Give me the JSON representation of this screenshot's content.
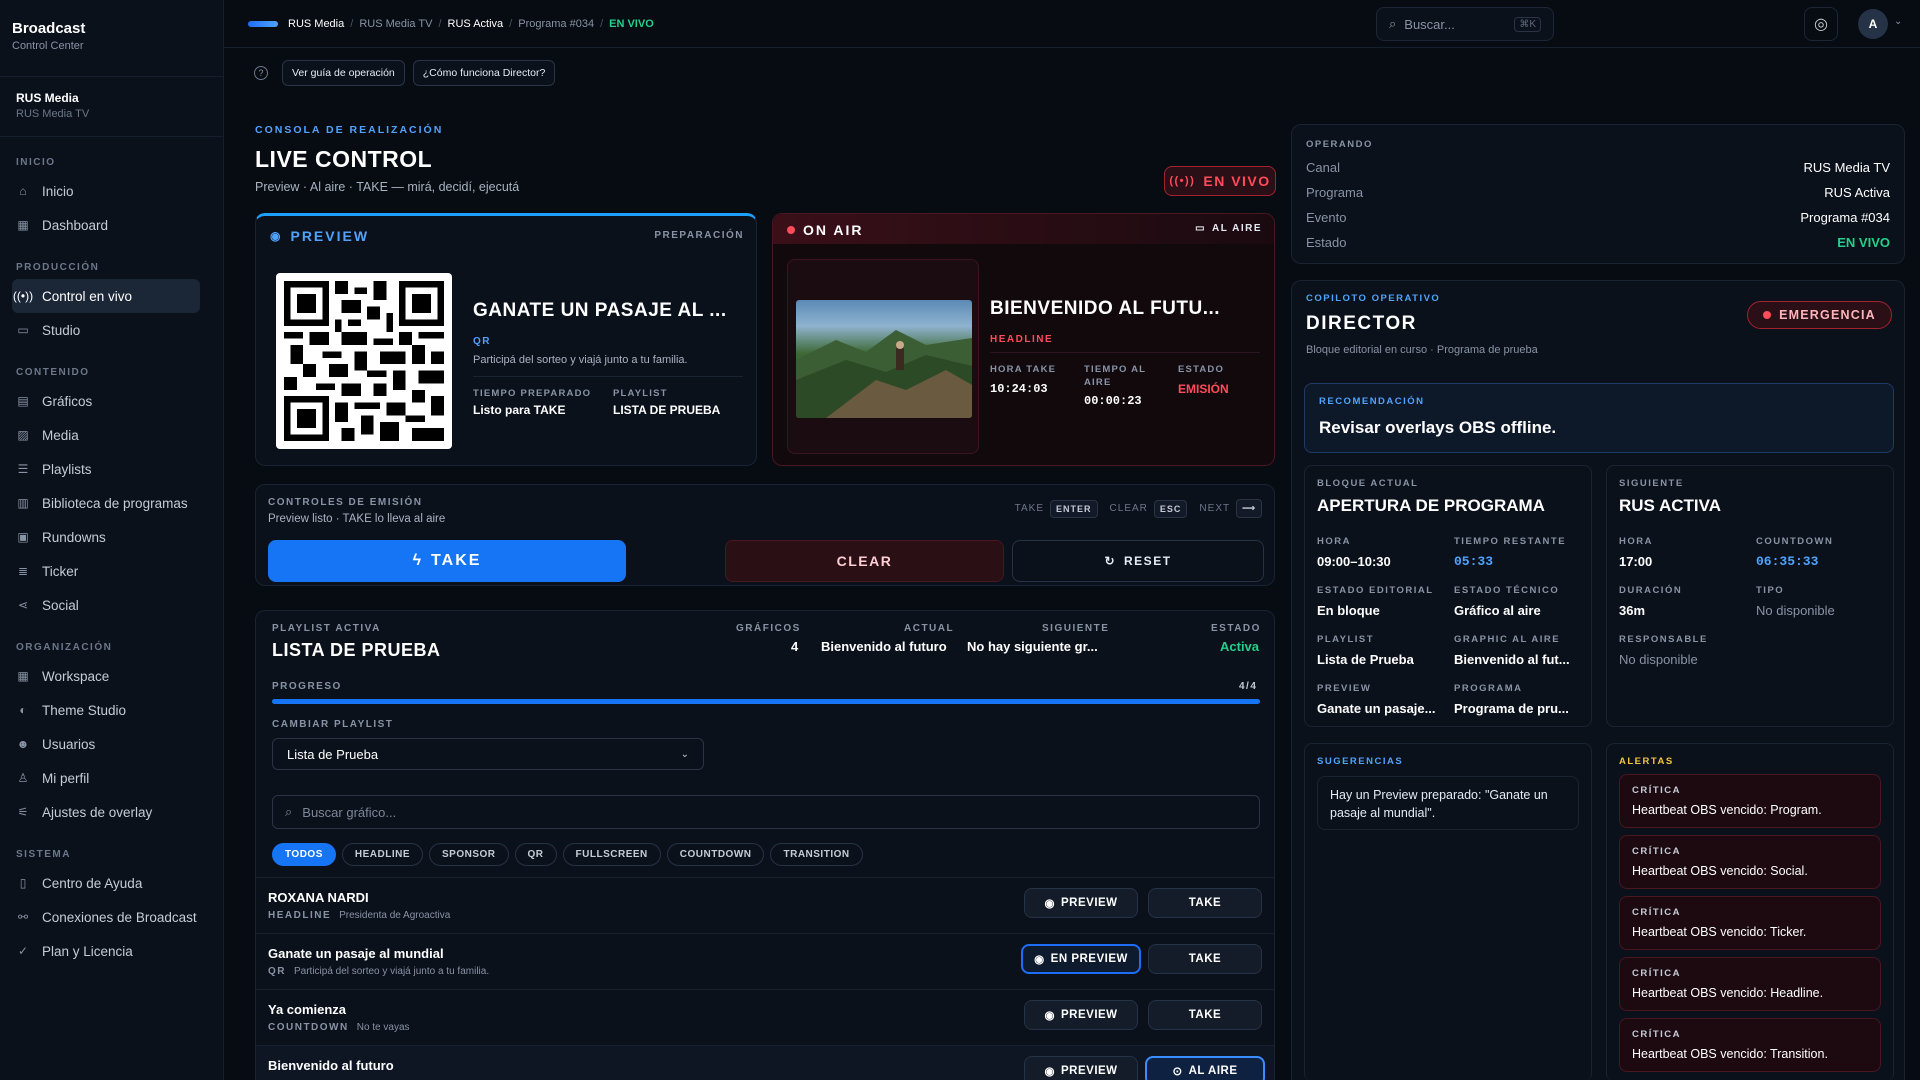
{
  "brand": {
    "title": "Broadcast",
    "subtitle": "Control Center"
  },
  "org": {
    "name": "RUS Media",
    "sub": "RUS Media TV"
  },
  "nav": {
    "inicio_label": "INICIO",
    "inicio": [
      "Inicio",
      "Dashboard"
    ],
    "produccion_label": "PRODUCCIÓN",
    "produccion": [
      "Control en vivo",
      "Studio"
    ],
    "contenido_label": "CONTENIDO",
    "contenido": [
      "Gráficos",
      "Media",
      "Playlists",
      "Biblioteca de programas",
      "Rundowns",
      "Ticker",
      "Social"
    ],
    "organizacion_label": "ORGANIZACIÓN",
    "organizacion": [
      "Workspace",
      "Theme Studio",
      "Usuarios",
      "Mi perfil",
      "Ajustes de overlay"
    ],
    "sistema_label": "SISTEMA",
    "sistema": [
      "Centro de Ayuda",
      "Conexiones de Broadcast",
      "Plan y Licencia"
    ]
  },
  "topbar": {
    "crumbs": [
      "RUS Media",
      "RUS Media TV",
      "RUS Activa",
      "Programa #034",
      "EN VIVO"
    ],
    "search_placeholder": "Buscar...",
    "search_kbd": "⌘K",
    "avatar": "A"
  },
  "help": {
    "guide": "Ver guía de operación",
    "how": "¿Cómo funciona Director?"
  },
  "header": {
    "kicker": "CONSOLA DE REALIZACIÓN",
    "title": "LIVE CONTROL",
    "subtitle": "Preview · Al aire · TAKE — mirá, decidí, ejecutá",
    "live": "EN VIVO"
  },
  "preview": {
    "label": "PREVIEW",
    "right": "PREPARACIÓN",
    "title": "GANATE UN PASAJE AL ...",
    "type": "QR",
    "desc": "Participá del sorteo y viajá junto a tu familia.",
    "k1": "TIEMPO PREPARADO",
    "v1": "Listo para TAKE",
    "k2": "PLAYLIST",
    "v2": "LISTA DE PRUEBA"
  },
  "onair": {
    "label": "ON AIR",
    "right": "AL AIRE",
    "title": "BIENVENIDO AL FUTU...",
    "type": "HEADLINE",
    "k1": "HORA TAKE",
    "v1": "10:24:03",
    "k2a": "TIEMPO AL",
    "k2b": "AIRE",
    "v2": "00:00:23",
    "k3": "ESTADO",
    "v3": "EMISIÓN"
  },
  "controls": {
    "title": "CONTROLES DE EMISIÓN",
    "sub": "Preview listo · TAKE lo lleva al aire",
    "take_key_label": "TAKE",
    "take_key": "ENTER",
    "clear_key_label": "CLEAR",
    "clear_key": "ESC",
    "next_key_label": "NEXT",
    "next_key": "⟶",
    "take": "TAKE",
    "clear": "CLEAR",
    "reset": "RESET"
  },
  "playlist": {
    "kicker": "PLAYLIST ACTIVA",
    "name": "LISTA DE PRUEBA",
    "k_graficos": "GRÁFICOS",
    "graficos": "4",
    "k_actual": "ACTUAL",
    "actual": "Bienvenido al futuro",
    "k_siguiente": "SIGUIENTE",
    "siguiente": "No hay siguiente gr...",
    "k_estado": "ESTADO",
    "estado": "Activa",
    "k_progreso": "PROGRESO",
    "progreso_text": "4/4",
    "progreso": 1.0,
    "k_cambiar": "CAMBIAR PLAYLIST",
    "select": "Lista de Prueba",
    "search_placeholder": "Buscar gráfico...",
    "chips": [
      "TODOS",
      "HEADLINE",
      "SPONSOR",
      "QR",
      "FULLSCREEN",
      "COUNTDOWN",
      "TRANSITION"
    ],
    "rows": [
      {
        "name": "ROXANA NARDI",
        "type": "HEADLINE",
        "desc": "Presidenta de Agroactiva",
        "b1": "PREVIEW",
        "b2": "TAKE"
      },
      {
        "name": "Ganate un pasaje al mundial",
        "type": "QR",
        "desc": "Participá del sorteo y viajá junto a tu familia.",
        "b1": "EN PREVIEW",
        "b2": "TAKE"
      },
      {
        "name": "Ya comienza",
        "type": "COUNTDOWN",
        "desc": "No te vayas",
        "b1": "PREVIEW",
        "b2": "TAKE"
      },
      {
        "name": "Bienvenido al futuro",
        "type": "HEADLINE",
        "desc": "",
        "b1": "PREVIEW",
        "b2": "AL AIRE"
      }
    ]
  },
  "operando": {
    "kicker": "OPERANDO",
    "rows": [
      [
        "Canal",
        "RUS Media TV"
      ],
      [
        "Programa",
        "RUS Activa"
      ],
      [
        "Evento",
        "Programa #034"
      ],
      [
        "Estado",
        "EN VIVO"
      ]
    ]
  },
  "director": {
    "kicker": "COPILOTO OPERATIVO",
    "title": "DIRECTOR",
    "sub": "Bloque editorial en curso · Programa de prueba",
    "emergency": "EMERGENCIA",
    "rec_k": "RECOMENDACIÓN",
    "rec_v": "Revisar overlays OBS offline.",
    "bloque": {
      "kicker": "BLOQUE ACTUAL",
      "title": "APERTURA DE PROGRAMA",
      "k1": "HORA",
      "v1": "09:00–10:30",
      "k2": "TIEMPO RESTANTE",
      "v2": "05:33",
      "k3": "ESTADO EDITORIAL",
      "v3": "En bloque",
      "k4": "ESTADO TÉCNICO",
      "v4": "Gráfico al aire",
      "k5": "PLAYLIST",
      "v5": "Lista de Prueba",
      "k6": "GRAPHIC AL AIRE",
      "v6": "Bienvenido al fut...",
      "k7": "PREVIEW",
      "v7": "Ganate un pasaje...",
      "k8": "PROGRAMA",
      "v8": "Programa de pru..."
    },
    "siguiente": {
      "kicker": "SIGUIENTE",
      "title": "RUS ACTIVA",
      "k1": "HORA",
      "v1": "17:00",
      "k2": "COUNTDOWN",
      "v2": "06:35:33",
      "k3": "DURACIÓN",
      "v3": "36m",
      "k4": "TIPO",
      "v4": "No disponible",
      "k5": "RESPONSABLE",
      "v5": "No disponible"
    },
    "sugerencias_k": "SUGERENCIAS",
    "sugerencia": "Hay un Preview preparado: \"Ganate un pasaje al mundial\".",
    "alertas_k": "ALERTAS",
    "alerts": [
      {
        "level": "CRÍTICA",
        "text": "Heartbeat OBS vencido: Program."
      },
      {
        "level": "CRÍTICA",
        "text": "Heartbeat OBS vencido: Social."
      },
      {
        "level": "CRÍTICA",
        "text": "Heartbeat OBS vencido: Ticker."
      },
      {
        "level": "CRÍTICA",
        "text": "Heartbeat OBS vencido: Headline."
      },
      {
        "level": "CRÍTICA",
        "text": "Heartbeat OBS vencido: Transition."
      }
    ]
  },
  "colors": {
    "accent": "#1675f5",
    "live_red": "#ff4b5a",
    "live_green": "#22d08a",
    "warn": "#f5c542"
  }
}
